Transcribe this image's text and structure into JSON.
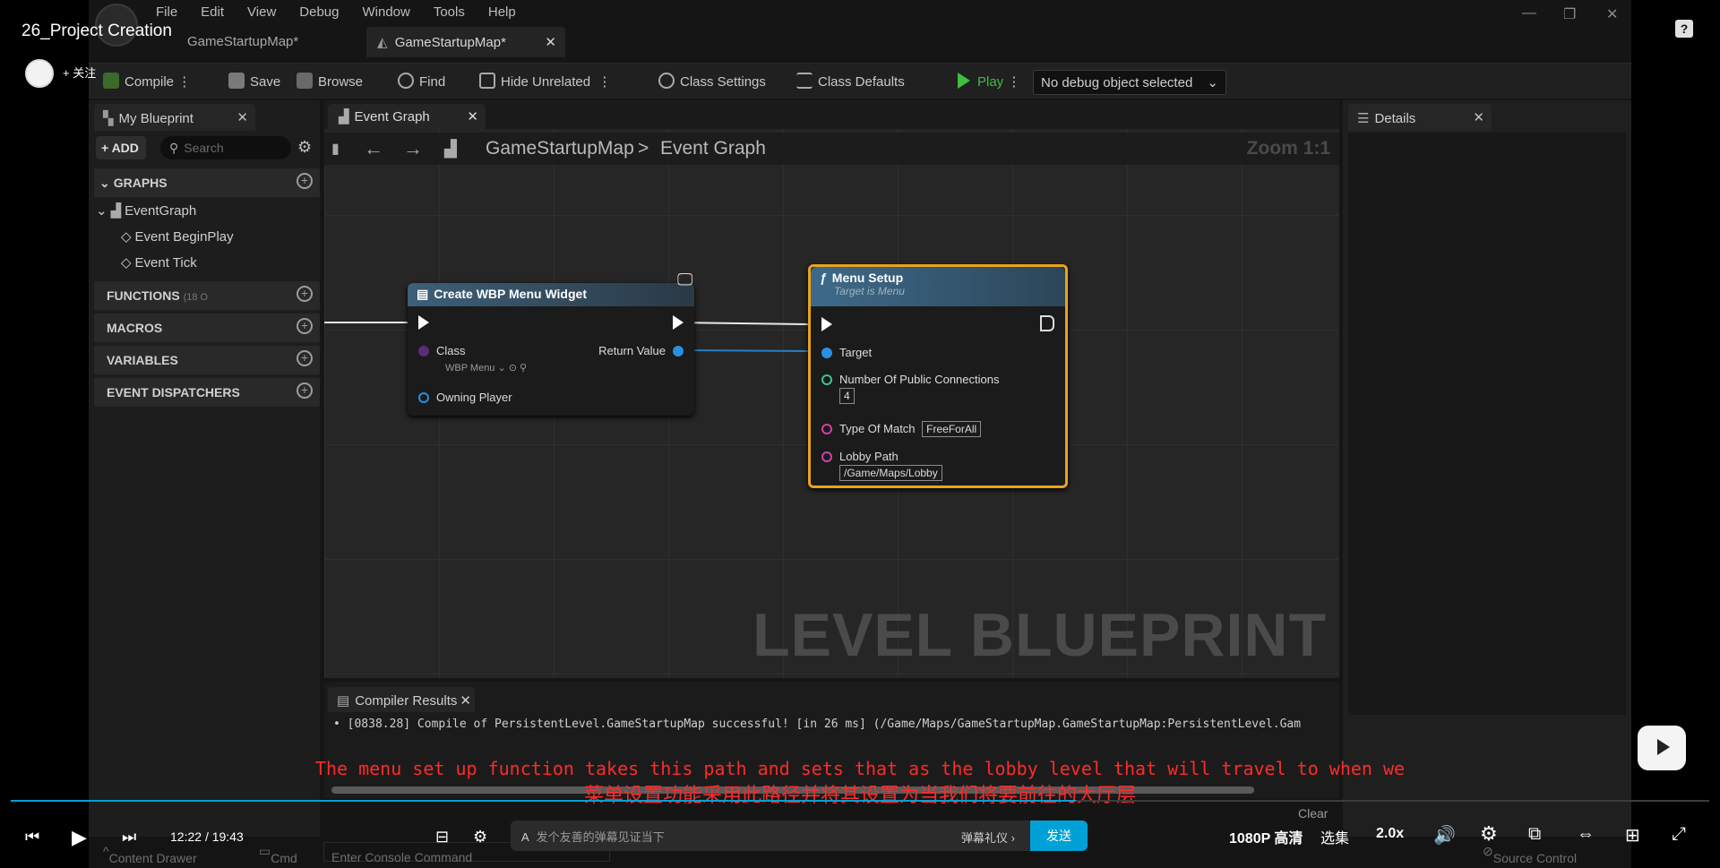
{
  "player": {
    "video_title": "26_Project Creation",
    "follow_label": "+ 关注",
    "help_icon": "?",
    "time_current": "12:22",
    "time_total": "19:43",
    "time_separator": "/",
    "progress_fraction": 0.627,
    "danmaku_placeholder": "发个友善的弹幕见证当下",
    "danmaku_etiquette": "弹幕礼仪 ›",
    "send_label": "发送",
    "quality_label": "1080P 高清",
    "episodes_label": "选集",
    "speed_label": "2.0x",
    "accent_color": "#00a1d6"
  },
  "subtitles": {
    "english": "The menu set up function takes this path and sets that as the lobby level that will travel to when we",
    "chinese": "菜单设置功能采用此路径并将其设置为当我们将要前往的大厅层"
  },
  "unreal": {
    "menu": [
      "File",
      "Edit",
      "View",
      "Debug",
      "Window",
      "Tools",
      "Help"
    ],
    "doc_tabs": [
      "GameStartupMap*",
      "GameStartupMap*"
    ],
    "toolbar": {
      "compile": "Compile",
      "save": "Save",
      "browse": "Browse",
      "find": "Find",
      "hide_unrelated": "Hide Unrelated",
      "class_settings": "Class Settings",
      "class_defaults": "Class Defaults",
      "play": "Play",
      "debug_object": "No debug object selected"
    },
    "my_blueprint": {
      "tab": "My Blueprint",
      "add_label": "ADD",
      "search_placeholder": "Search",
      "graphs": "GRAPHS",
      "event_graph": "EventGraph",
      "event_begin_play": "Event BeginPlay",
      "event_tick": "Event Tick",
      "functions": "FUNCTIONS",
      "functions_count": "(18 O",
      "macros": "MACROS",
      "variables": "VARIABLES",
      "event_dispatchers": "EVENT DISPATCHERS"
    },
    "graph": {
      "tab": "Event Graph",
      "crumb_root": "GameStartupMap",
      "crumb_sep": ">",
      "crumb_leaf": "Event Graph",
      "zoom": "Zoom 1:1",
      "watermark": "LEVEL BLUEPRINT"
    },
    "node_create": {
      "title": "Create WBP Menu Widget",
      "class_label": "Class",
      "class_value": "WBP Menu",
      "owning_player": "Owning Player",
      "return_value": "Return Value"
    },
    "node_menu_setup": {
      "title": "Menu Setup",
      "subtitle": "Target is Menu",
      "target": "Target",
      "num_connections": "Number Of Public Connections",
      "num_connections_value": "4",
      "type_of_match": "Type Of Match",
      "type_of_match_value": "FreeForAll",
      "lobby_path": "Lobby Path",
      "lobby_path_value": "/Game/Maps/Lobby"
    },
    "compiler": {
      "tab": "Compiler Results",
      "line": "• [0838.28] Compile of PersistentLevel.GameStartupMap successful! [in 26 ms] (/Game/Maps/GameStartupMap.GameStartupMap:PersistentLevel.Gam",
      "clear": "Clear"
    },
    "details": {
      "tab": "Details"
    },
    "bottom": {
      "content_drawer": "Content Drawer",
      "cmd": "Cmd",
      "console_placeholder": "Enter Console Command",
      "source_control": "Source Control"
    }
  }
}
